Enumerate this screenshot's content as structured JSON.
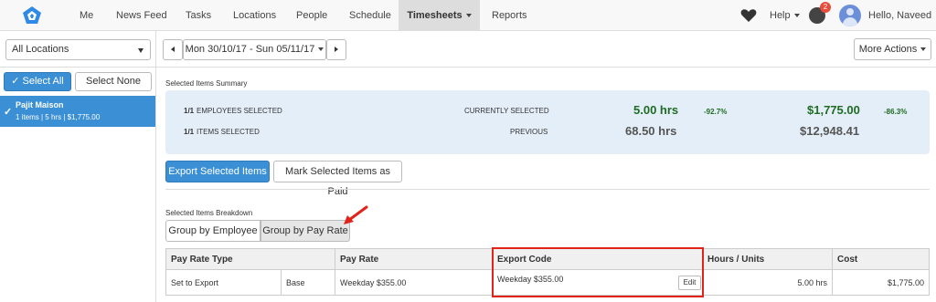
{
  "nav": {
    "items": [
      "Me",
      "News Feed",
      "Tasks",
      "Locations",
      "People",
      "Schedule",
      "Timesheets",
      "Reports"
    ],
    "active": "Timesheets",
    "help": "Help",
    "notifications_count": "2",
    "greeting": "Hello, Naveed"
  },
  "toolbar": {
    "location_select": "All Locations",
    "date_range": "Mon 30/10/17 - Sun 05/11/17",
    "more_actions": "More Actions"
  },
  "sidebar": {
    "select_all": "✓ Select All",
    "select_none": "Select None",
    "employees": [
      {
        "name": "Pajit Maison",
        "details": "1 items | 5 hrs | $1,775.00"
      }
    ]
  },
  "summary": {
    "heading": "Selected Items Summary",
    "employees_fraction": "1/1",
    "employees_label": "EMPLOYEES SELECTED",
    "items_fraction": "1/1",
    "items_label": "ITEMS SELECTED",
    "currently_selected_label": "CURRENTLY SELECTED",
    "previous_label": "PREVIOUS",
    "current_hours": "5.00 hrs",
    "hours_pct": "-92.7%",
    "current_cost": "$1,775.00",
    "cost_pct": "-86.3%",
    "previous_hours": "68.50 hrs",
    "previous_cost": "$12,948.41"
  },
  "actions": {
    "export": "Export Selected Items",
    "mark_paid": "Mark Selected Items as Paid"
  },
  "breakdown": {
    "heading": "Selected Items Breakdown",
    "group_employee": "Group by Employee",
    "group_payrate": "Group by Pay Rate"
  },
  "table": {
    "headers": [
      "Pay Rate Type",
      "Pay Rate",
      "Export Code",
      "Hours / Units",
      "Cost"
    ],
    "rows": [
      {
        "type": "Set to Export",
        "sub": "Base",
        "rate": "Weekday $355.00",
        "code": "Weekday $355.00",
        "hours": "5.00 hrs",
        "cost": "$1,775.00"
      }
    ],
    "edit": "Edit"
  },
  "colors": {
    "primary": "#3b8fd5",
    "highlight": "#e2231a",
    "positive": "#1e6b22"
  }
}
